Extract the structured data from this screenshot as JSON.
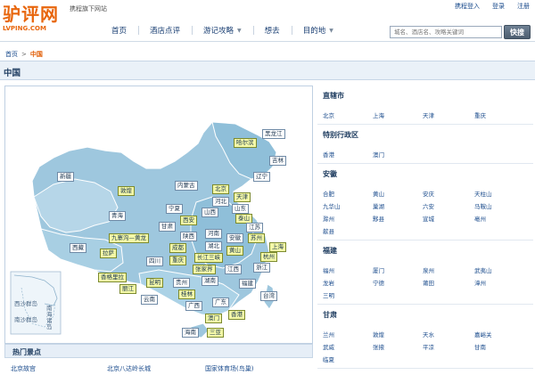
{
  "header": {
    "logo_cn": "驴评网",
    "logo_en": "LVPING.COM",
    "tagline": "携程旗下网站",
    "top_links": [
      "携程登入",
      "登录",
      "注册"
    ],
    "nav": [
      {
        "label": "首页",
        "has_dropdown": false
      },
      {
        "label": "酒店点评",
        "has_dropdown": false
      },
      {
        "label": "游记攻略",
        "has_dropdown": true
      },
      {
        "label": "想去",
        "has_dropdown": false
      },
      {
        "label": "目的地",
        "has_dropdown": true
      }
    ],
    "search_placeholder": "城名、酒店名、攻略关键词",
    "search_button": "快搜"
  },
  "breadcrumb": {
    "home": "首页",
    "sep": ">",
    "current": "中国"
  },
  "page_title": "中国",
  "map": {
    "labels": {
      "heilongjiang": "黑龙江",
      "harbin": "哈尔滨",
      "jilin": "吉林",
      "liaoning": "辽宁",
      "neimenggu": "内蒙古",
      "xinjiang": "新疆",
      "dunhuang": "敦煌",
      "beijing": "北京",
      "tianjin": "天津",
      "hebei": "河北",
      "shanxi": "山西",
      "shandong": "山东",
      "taishan": "泰山",
      "ningxia": "宁夏",
      "qinghai": "青海",
      "gansu": "甘肃",
      "xian": "西安",
      "henan": "河南",
      "jiangsu": "江苏",
      "jiuzhaigou": "九寨沟—黄龙",
      "shaanxi": "陕西",
      "anhui": "安徽",
      "suzhou": "苏州",
      "shanghai": "上海",
      "xizang": "西藏",
      "chengdu": "成都",
      "hubei": "湖北",
      "huangshan": "黄山",
      "hangzhou": "杭州",
      "lasa": "拉萨",
      "chongqing": "重庆",
      "changjiang": "长江三峡",
      "sichuan": "四川",
      "zhejiang": "浙江",
      "jiangxi": "江西",
      "zhangjiajie": "张家界",
      "shangrila": "香格里拉",
      "kunming": "昆明",
      "guizhou": "贵州",
      "hunan": "湖南",
      "fujian": "福建",
      "lijiang": "丽江",
      "guilin": "桂林",
      "taiwan": "台湾",
      "yunnan": "云南",
      "guangxi": "广西",
      "guangdong": "广东",
      "macau": "澳门",
      "hongkong": "香港",
      "hainan": "海南",
      "sanya": "三亚",
      "xisha": "西沙群岛",
      "nansha": "南沙群岛",
      "nanhai": "南海诸岛"
    }
  },
  "hot_spots": {
    "title": "热门景点",
    "items": [
      "北京故宫",
      "北京八达岭长城",
      "国家体育场(鸟巢)"
    ]
  },
  "regions": [
    {
      "title": "直辖市",
      "cities": [
        "北京",
        "上海",
        "天津",
        "重庆"
      ]
    },
    {
      "title": "特别行政区",
      "cities": [
        "香港",
        "澳门"
      ]
    },
    {
      "title": "安徽",
      "cities": [
        "合肥",
        "黄山",
        "安庆",
        "天柱山",
        "九华山",
        "巢湖",
        "六安",
        "马鞍山",
        "滁州",
        "黟县",
        "宣城",
        "亳州",
        "歙县"
      ]
    },
    {
      "title": "福建",
      "cities": [
        "福州",
        "厦门",
        "泉州",
        "武夷山",
        "龙岩",
        "宁德",
        "莆田",
        "漳州",
        "三明"
      ]
    },
    {
      "title": "甘肃",
      "cities": [
        "兰州",
        "敦煌",
        "天水",
        "嘉峪关",
        "武威",
        "张掖",
        "平凉",
        "甘南",
        "临夏"
      ]
    },
    {
      "title": "",
      "cities": []
    }
  ],
  "colors": {
    "accent": "#e8660d",
    "link": "#1a4b8c",
    "map_land": "#9ec7de",
    "map_highlight": "#f4f9a8"
  }
}
